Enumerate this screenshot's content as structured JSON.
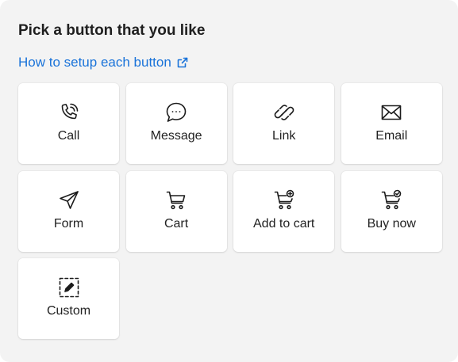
{
  "title": "Pick a button that you like",
  "help_link": {
    "label": "How to setup each button",
    "icon": "external-link-icon",
    "color": "#1a73d9"
  },
  "buttons": [
    {
      "label": "Call",
      "icon": "phone-icon"
    },
    {
      "label": "Message",
      "icon": "chat-bubble-icon"
    },
    {
      "label": "Link",
      "icon": "link-icon"
    },
    {
      "label": "Email",
      "icon": "envelope-icon"
    },
    {
      "label": "Form",
      "icon": "paper-plane-icon"
    },
    {
      "label": "Cart",
      "icon": "cart-icon"
    },
    {
      "label": "Add to cart",
      "icon": "cart-add-icon"
    },
    {
      "label": "Buy now",
      "icon": "cart-check-icon"
    },
    {
      "label": "Custom",
      "icon": "custom-edit-icon"
    }
  ]
}
